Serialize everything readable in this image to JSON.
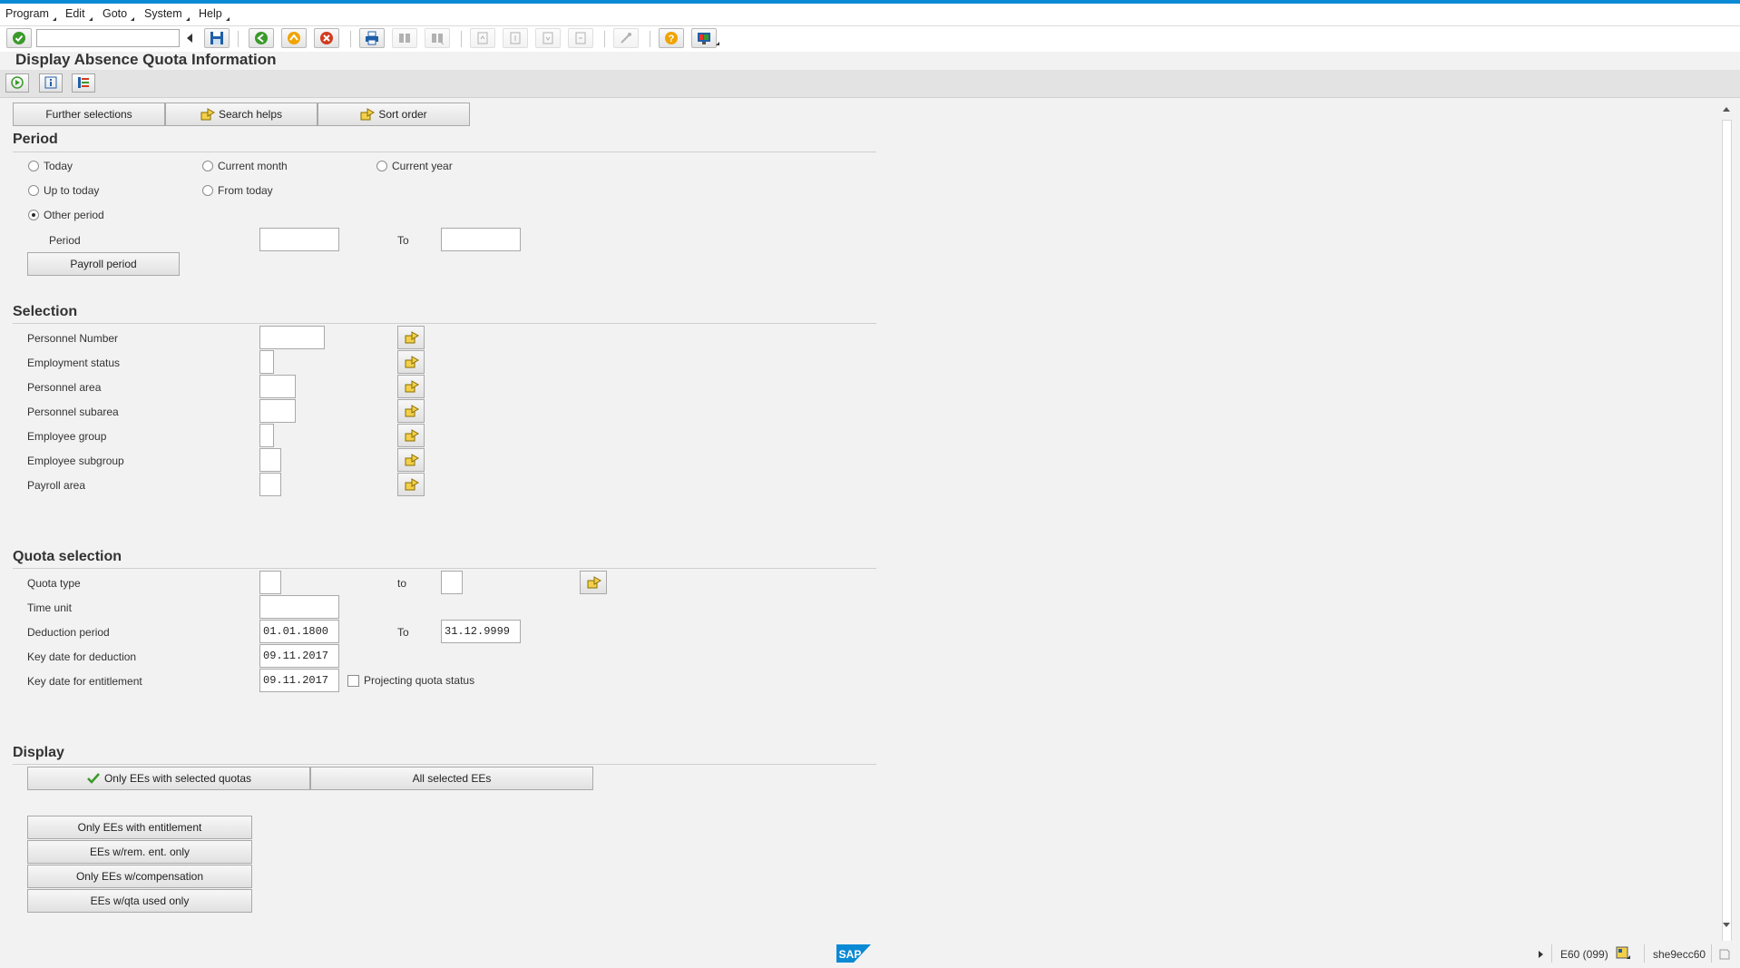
{
  "menu": [
    "Program",
    "Edit",
    "Goto",
    "System",
    "Help"
  ],
  "toolbar": {
    "command_value": "",
    "icons": [
      "enter-icon",
      "back-icon",
      "exit-icon",
      "cancel-icon",
      "print-icon",
      "find-icon",
      "find-next-icon",
      "first-page-icon",
      "previous-page-icon",
      "next-page-icon",
      "last-page-icon",
      "create-session-icon",
      "help-icon",
      "customize-layout-icon"
    ]
  },
  "page_title": "Display Absence Quota Information",
  "appbar_icons": [
    "execute-icon",
    "info-icon",
    "selection-options-icon"
  ],
  "tabs": {
    "further_selections": "Further selections",
    "search_helps": "Search helps",
    "sort_order": "Sort order"
  },
  "period": {
    "title": "Period",
    "options": {
      "today": "Today",
      "current_month": "Current month",
      "current_year": "Current year",
      "up_to_today": "Up to today",
      "from_today": "From today",
      "other_period": "Other period"
    },
    "selected": "other_period",
    "period_label": "Period",
    "period_from": "",
    "to_label": "To",
    "period_to": "",
    "payroll_button": "Payroll period"
  },
  "selection": {
    "title": "Selection",
    "rows": [
      {
        "label": "Personnel Number",
        "value": ""
      },
      {
        "label": "Employment status",
        "value": ""
      },
      {
        "label": "Personnel area",
        "value": ""
      },
      {
        "label": "Personnel subarea",
        "value": ""
      },
      {
        "label": "Employee group",
        "value": ""
      },
      {
        "label": "Employee subgroup",
        "value": ""
      },
      {
        "label": "Payroll area",
        "value": ""
      }
    ]
  },
  "quota": {
    "title": "Quota selection",
    "quota_type_label": "Quota type",
    "quota_type_from": "",
    "quota_to_label": "to",
    "quota_type_to": "",
    "time_unit_label": "Time unit",
    "time_unit": "",
    "deduction_label": "Deduction period",
    "deduction_from": "01.01.1800",
    "deduction_to_label": "To",
    "deduction_to": "31.12.9999",
    "key_deduction_label": "Key date for deduction",
    "key_deduction": "09.11.2017",
    "key_entitlement_label": "Key date for entitlement",
    "key_entitlement": "09.11.2017",
    "projecting_label": "Projecting quota status",
    "projecting_checked": false
  },
  "display": {
    "title": "Display",
    "only_selected_quotas": "Only EEs with selected quotas",
    "all_selected": "All selected EEs",
    "only_entitlement": "Only EEs with entitlement",
    "rem_ent_only": "EEs w/rem. ent. only",
    "only_compensation": "Only EEs w/compensation",
    "qta_used_only": "EEs w/qta used only"
  },
  "status": {
    "system": "E60 (099)",
    "server": "she9ecc60",
    "logo": "SAP"
  },
  "colors": {
    "accent": "#0a8ad4",
    "check_green": "#3a9a2a"
  }
}
